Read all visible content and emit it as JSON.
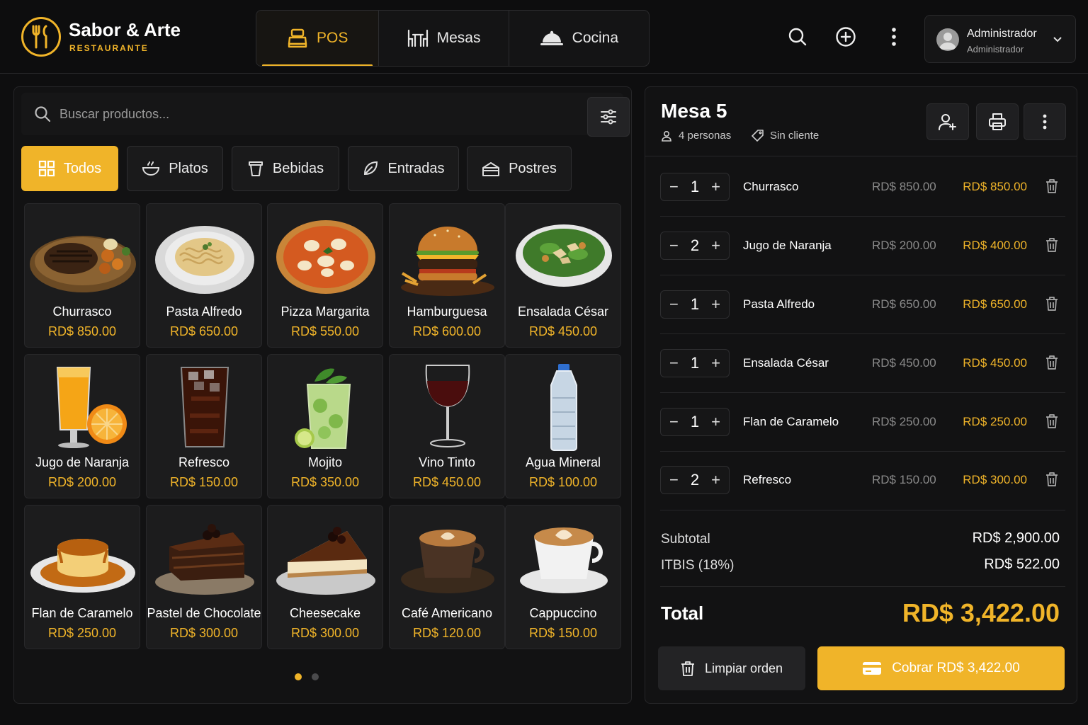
{
  "brand": {
    "name": "Sabor & Arte",
    "subtitle": "RESTAURANTE"
  },
  "nav": {
    "tabs": [
      {
        "label": "POS",
        "icon": "pos-register-icon",
        "active": true
      },
      {
        "label": "Mesas",
        "icon": "table-chairs-icon",
        "active": false
      },
      {
        "label": "Cocina",
        "icon": "cloche-icon",
        "active": false
      }
    ]
  },
  "header_actions": [
    "search-icon",
    "add-circle-icon",
    "more-vertical-icon"
  ],
  "user": {
    "name": "Administrador",
    "role": "Administrador"
  },
  "search": {
    "placeholder": "Buscar productos..."
  },
  "categories": [
    {
      "label": "Todos",
      "icon": "grid-icon",
      "active": true
    },
    {
      "label": "Platos",
      "icon": "bowl-icon",
      "active": false
    },
    {
      "label": "Bebidas",
      "icon": "cup-icon",
      "active": false
    },
    {
      "label": "Entradas",
      "icon": "leaf-icon",
      "active": false
    },
    {
      "label": "Postres",
      "icon": "cake-icon",
      "active": false
    }
  ],
  "products": [
    {
      "name": "Churrasco",
      "price": "RD$ 850.00",
      "icon": "steak-image"
    },
    {
      "name": "Pasta Alfredo",
      "price": "RD$ 650.00",
      "icon": "pasta-image"
    },
    {
      "name": "Pizza Margarita",
      "price": "RD$ 550.00",
      "icon": "pizza-image"
    },
    {
      "name": "Hamburguesa",
      "price": "RD$ 600.00",
      "icon": "burger-image"
    },
    {
      "name": "Ensalada César",
      "price": "RD$ 450.00",
      "icon": "salad-image"
    },
    {
      "name": "Jugo de Naranja",
      "price": "RD$ 200.00",
      "icon": "orange-juice-image"
    },
    {
      "name": "Refresco",
      "price": "RD$ 150.00",
      "icon": "soda-image"
    },
    {
      "name": "Mojito",
      "price": "RD$ 350.00",
      "icon": "mojito-image"
    },
    {
      "name": "Vino Tinto",
      "price": "RD$ 450.00",
      "icon": "wine-image"
    },
    {
      "name": "Agua Mineral",
      "price": "RD$ 100.00",
      "icon": "water-bottle-image"
    },
    {
      "name": "Flan de Caramelo",
      "price": "RD$ 250.00",
      "icon": "flan-image"
    },
    {
      "name": "Pastel de Chocolate",
      "price": "RD$ 300.00",
      "icon": "chocolate-cake-image"
    },
    {
      "name": "Cheesecake",
      "price": "RD$ 300.00",
      "icon": "cheesecake-image"
    },
    {
      "name": "Café Americano",
      "price": "RD$ 120.00",
      "icon": "coffee-image"
    },
    {
      "name": "Cappuccino",
      "price": "RD$ 150.00",
      "icon": "cappuccino-image"
    }
  ],
  "pagination": {
    "pages": 2,
    "current": 1
  },
  "order": {
    "table": "Mesa 5",
    "guests": "4 personas",
    "customer": "Sin cliente",
    "items": [
      {
        "qty": "1",
        "name": "Churrasco",
        "unit": "RD$ 850.00",
        "total": "RD$ 850.00"
      },
      {
        "qty": "2",
        "name": "Jugo de Naranja",
        "unit": "RD$ 200.00",
        "total": "RD$ 400.00"
      },
      {
        "qty": "1",
        "name": "Pasta Alfredo",
        "unit": "RD$ 650.00",
        "total": "RD$ 650.00"
      },
      {
        "qty": "1",
        "name": "Ensalada César",
        "unit": "RD$ 450.00",
        "total": "RD$ 450.00"
      },
      {
        "qty": "1",
        "name": "Flan de Caramelo",
        "unit": "RD$ 250.00",
        "total": "RD$ 250.00"
      },
      {
        "qty": "2",
        "name": "Refresco",
        "unit": "RD$ 150.00",
        "total": "RD$ 300.00"
      }
    ],
    "subtotal_label": "Subtotal",
    "subtotal": "RD$ 2,900.00",
    "tax_label": "ITBIS (18%)",
    "tax": "RD$ 522.00",
    "total_label": "Total",
    "total": "RD$ 3,422.00",
    "clear_label": "Limpiar orden",
    "pay_label": "Cobrar RD$ 3,422.00"
  },
  "colors": {
    "accent": "#f0b429",
    "background": "#0e0e0f",
    "panel": "#121213",
    "card": "#1c1c1d"
  }
}
